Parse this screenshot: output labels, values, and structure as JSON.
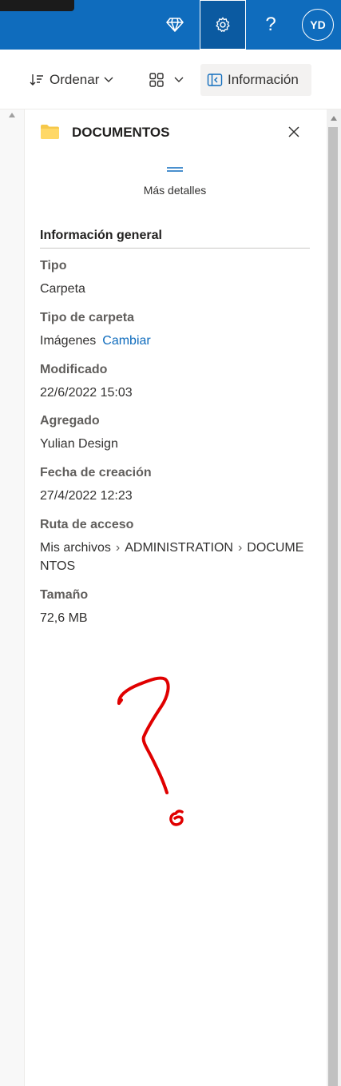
{
  "header": {
    "buttons": [
      {
        "name": "premium",
        "icon": "diamond-icon"
      },
      {
        "name": "settings",
        "icon": "gear-icon",
        "active": true
      },
      {
        "name": "help",
        "icon": "question-icon",
        "label": "?"
      }
    ],
    "avatar_initials": "YD",
    "accent_color": "#0f6cbd"
  },
  "toolbar": {
    "sort_label": "Ordenar",
    "view_icon": "grid-view-icon",
    "info_label": "Información"
  },
  "panel": {
    "folder_name": "DOCUMENTOS",
    "folder_icon": "folder-icon",
    "more_details": "Más detalles",
    "section_title": "Información general",
    "properties": {
      "tipo_label": "Tipo",
      "tipo_value": "Carpeta",
      "tipo_carpeta_label": "Tipo de carpeta",
      "tipo_carpeta_value": "Imágenes",
      "tipo_carpeta_action": "Cambiar",
      "modificado_label": "Modificado",
      "modificado_value": "22/6/2022 15:03",
      "agregado_label": "Agregado",
      "agregado_value": "Yulian Design",
      "creacion_label": "Fecha de creación",
      "creacion_value": "27/4/2022 12:23",
      "ruta_label": "Ruta de acceso",
      "ruta_parts": [
        "Mis archivos",
        "ADMINISTRATION",
        "DOCUMENTOS"
      ],
      "tamano_label": "Tamaño",
      "tamano_value": "72,6 MB"
    }
  },
  "annotation": {
    "symbol": "?",
    "number": "6",
    "color": "#e00000"
  }
}
